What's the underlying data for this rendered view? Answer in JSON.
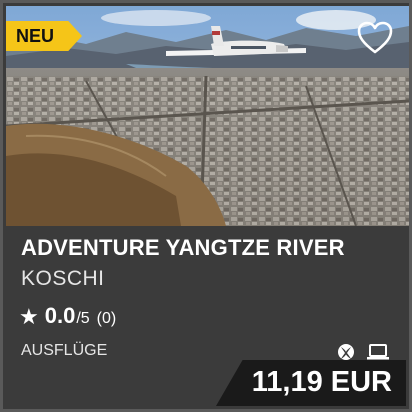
{
  "card": {
    "badge": "NEU",
    "title": "ADVENTURE YANGTZE RIVER",
    "publisher": "KOSCHI",
    "rating": {
      "score": "0.0",
      "out_of": "/5",
      "count": "(0)"
    },
    "category": "AUSFLÜGE",
    "platforms": [
      "xbox-icon",
      "laptop-icon"
    ],
    "price": "11,19 EUR"
  },
  "colors": {
    "badge_bg": "#f5c518",
    "card_bg": "#3b3b3b",
    "price_bg": "#1a1a1a"
  }
}
